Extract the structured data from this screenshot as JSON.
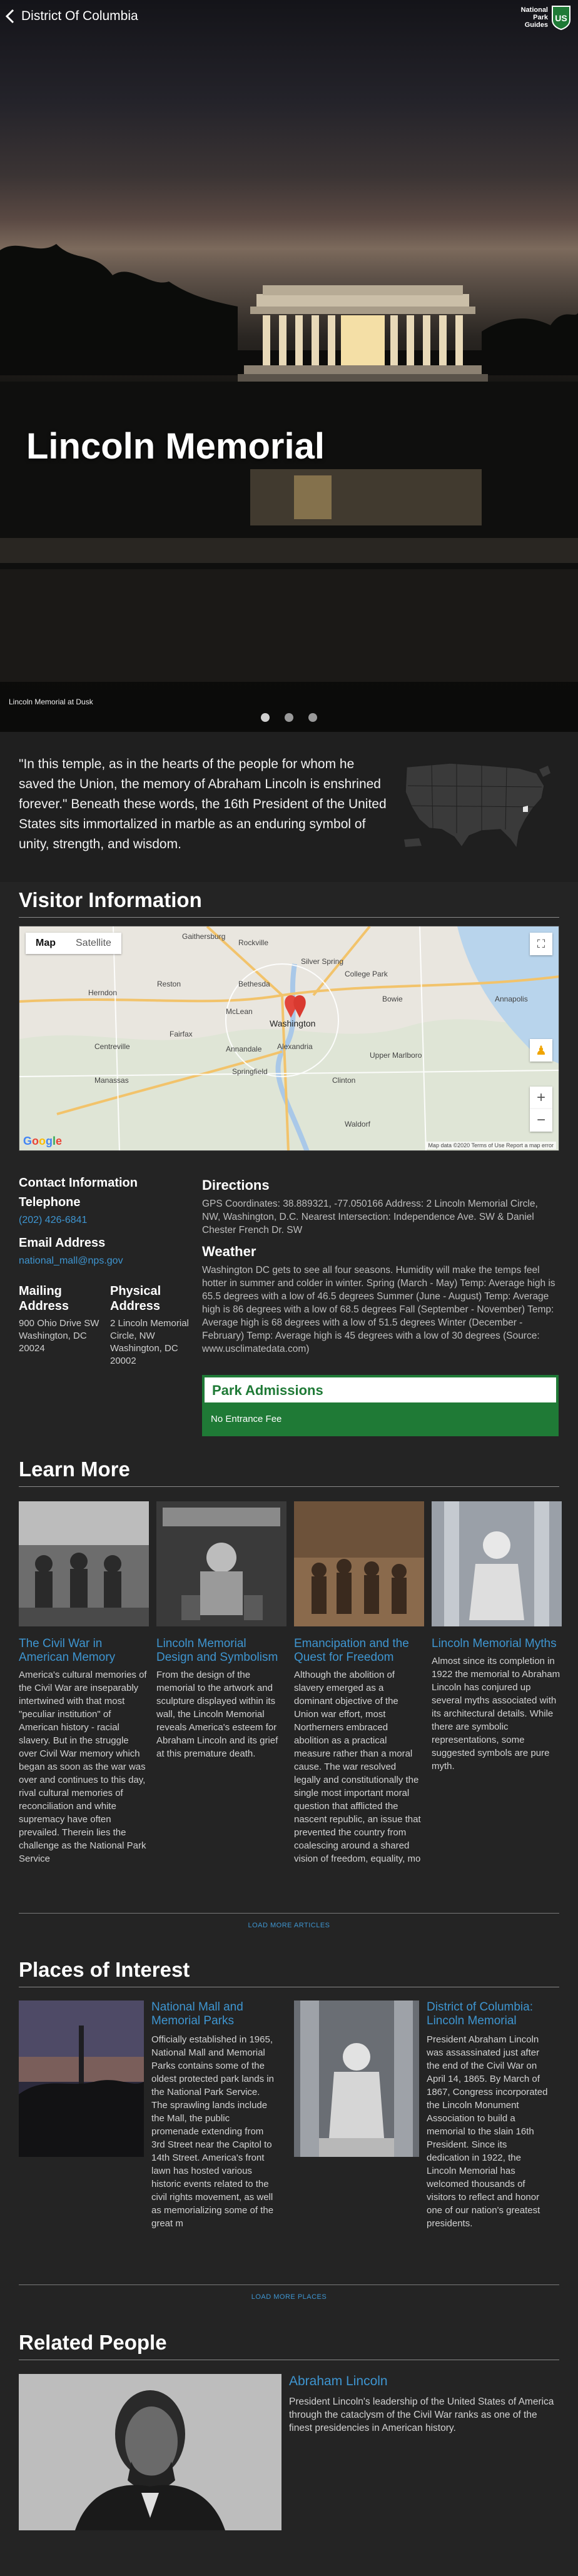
{
  "nav": {
    "back_label": "District Of Columbia",
    "logo_lines": [
      "National",
      "Park",
      "Guides"
    ],
    "logo_badge": "US"
  },
  "hero": {
    "title": "Lincoln Memorial",
    "caption": "Lincoln Memorial at Dusk",
    "slides": 3,
    "active_slide": 1
  },
  "intro": {
    "quote": "\"In this temple, as in the hearts of the people for whom he saved the Union, the memory of Abraham Lincoln is enshrined forever.\" Beneath these words, the 16th President of the United States sits immortalized in marble as an enduring symbol of unity, strength, and wisdom."
  },
  "visitor": {
    "title": "Visitor Information",
    "map": {
      "tab_map": "Map",
      "tab_satellite": "Satellite",
      "labels": [
        "Rockville",
        "Bethesda",
        "Reston",
        "Herndon",
        "McLean",
        "Washington",
        "Alexandria",
        "Annandale",
        "Centreville",
        "Fairfax",
        "Springfield",
        "Manassas",
        "Bowie",
        "Silver Spring",
        "College Park",
        "Upper Marlboro",
        "Waldorf",
        "Clinton",
        "Gaithersburg",
        "Annapolis"
      ],
      "footer": "Map data ©2020  Terms of Use  Report a map error",
      "google": "Google"
    },
    "contact": {
      "title": "Contact Information",
      "telephone_label": "Telephone",
      "telephone": "(202) 426-6841",
      "email_label": "Email Address",
      "email": "national_mall@nps.gov",
      "mailing_label": "Mailing Address",
      "mailing": "900 Ohio Drive SW Washington, DC 20024",
      "physical_label": "Physical Address",
      "physical": "2 Lincoln Memorial Circle, NW Washington, DC 20002"
    },
    "directions": {
      "title": "Directions",
      "text": "GPS Coordinates: 38.889321, -77.050166 Address: 2 Lincoln Memorial Circle, NW, Washington, D.C. Nearest Intersection: Independence Ave. SW & Daniel Chester French Dr. SW"
    },
    "weather": {
      "title": "Weather",
      "text": "Washington DC gets to see all four seasons. Humidity will make the temps feel hotter in summer and colder in winter. Spring (March - May) Temp: Average high is 65.5 degrees with a low of 46.5 degrees Summer (June - August) Temp: Average high is 86 degrees with a low of 68.5 degrees Fall (September - November) Temp: Average high is 68 degrees with a low of 51.5 degrees Winter (December - February) Temp: Average high is 45 degrees with a low of 30 degrees (Source: www.usclimatedata.com)"
    },
    "admissions": {
      "title": "Park Admissions",
      "fee": "No Entrance Fee"
    }
  },
  "learn_more": {
    "title": "Learn More",
    "load_more": "LOAD MORE ARTICLES",
    "articles": [
      {
        "title": "The Civil War in American Memory",
        "text": "America's cultural memories of the Civil War are inseparably intertwined with that most \"peculiar institution\" of American history - racial slavery. But in the struggle over Civil War memory which began as soon as the war was over and continues to this day, rival cultural memories of reconciliation and white supremacy have often prevailed. Therein lies the challenge as the National Park Service"
      },
      {
        "title": "Lincoln Memorial Design and Symbolism",
        "text": "From the design of the memorial to the artwork and sculpture displayed within its wall, the Lincoln Memorial reveals America's esteem for Abraham Lincoln and its grief at this premature death."
      },
      {
        "title": "Emancipation and the Quest for Freedom",
        "text": "Although the abolition of slavery emerged as a dominant objective of the Union war effort, most Northerners embraced abolition as a practical measure rather than a moral cause. The war resolved legally and constitutionally the single most important moral question that afflicted the nascent republic, an issue that prevented the country from coalescing around a shared vision of freedom, equality, mo"
      },
      {
        "title": "Lincoln Memorial Myths",
        "text": "Almost since its completion in 1922 the memorial to Abraham Lincoln has conjured up several myths associated with its architectural details. While there are symbolic representations, some suggested symbols are pure myth."
      }
    ]
  },
  "places": {
    "title": "Places of Interest",
    "load_more": "LOAD MORE PLACES",
    "items": [
      {
        "title": "National Mall and Memorial Parks",
        "text": "Officially established in 1965, National Mall and Memorial Parks contains some of the oldest protected park lands in the National Park Service. The sprawling lands include the Mall, the public promenade extending from 3rd Street near the Capitol to 14th Street. America's front lawn has hosted various historic events related to the civil rights movement, as well as memorializing some of the great m"
      },
      {
        "title": "District of Columbia: Lincoln Memorial",
        "text": "President Abraham Lincoln was assassinated just after the end of the Civil War on April 14, 1865. By March of 1867, Congress incorporated the Lincoln Monument Association to build a memorial to the slain 16th President. Since its dedication in 1922, the Lincoln Memorial has welcomed thousands of visitors to reflect and honor one of our nation's greatest presidents."
      }
    ]
  },
  "people": {
    "title": "Related People",
    "items": [
      {
        "name": "Abraham Lincoln",
        "text": "President Lincoln's leadership of the United States of America through the cataclysm of the Civil War ranks as one of the finest presidencies in American history."
      }
    ]
  },
  "colors": {
    "link": "#3e95d0",
    "background": "#242424",
    "admissions_green": "#1f7a36"
  }
}
